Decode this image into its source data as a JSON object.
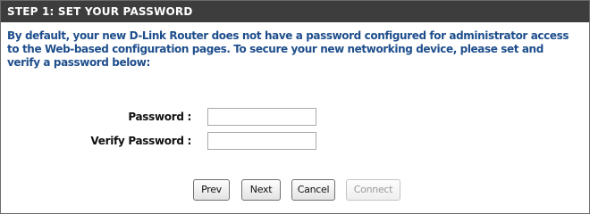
{
  "step_header": "STEP 1: SET YOUR PASSWORD",
  "description": "By default, your new D-Link Router does not have a password configured for administrator access to the Web-based configuration pages. To secure your new networking device, please set and verify a password below:",
  "form": {
    "password_label": "Password :",
    "password_value": "",
    "verify_label": "Verify Password :",
    "verify_value": ""
  },
  "buttons": {
    "prev": "Prev",
    "next": "Next",
    "cancel": "Cancel",
    "connect": "Connect"
  },
  "colors": {
    "header_bg": "#3d3d3d",
    "description_text": "#1e4e8c",
    "disabled_text": "#9a9a9a"
  }
}
